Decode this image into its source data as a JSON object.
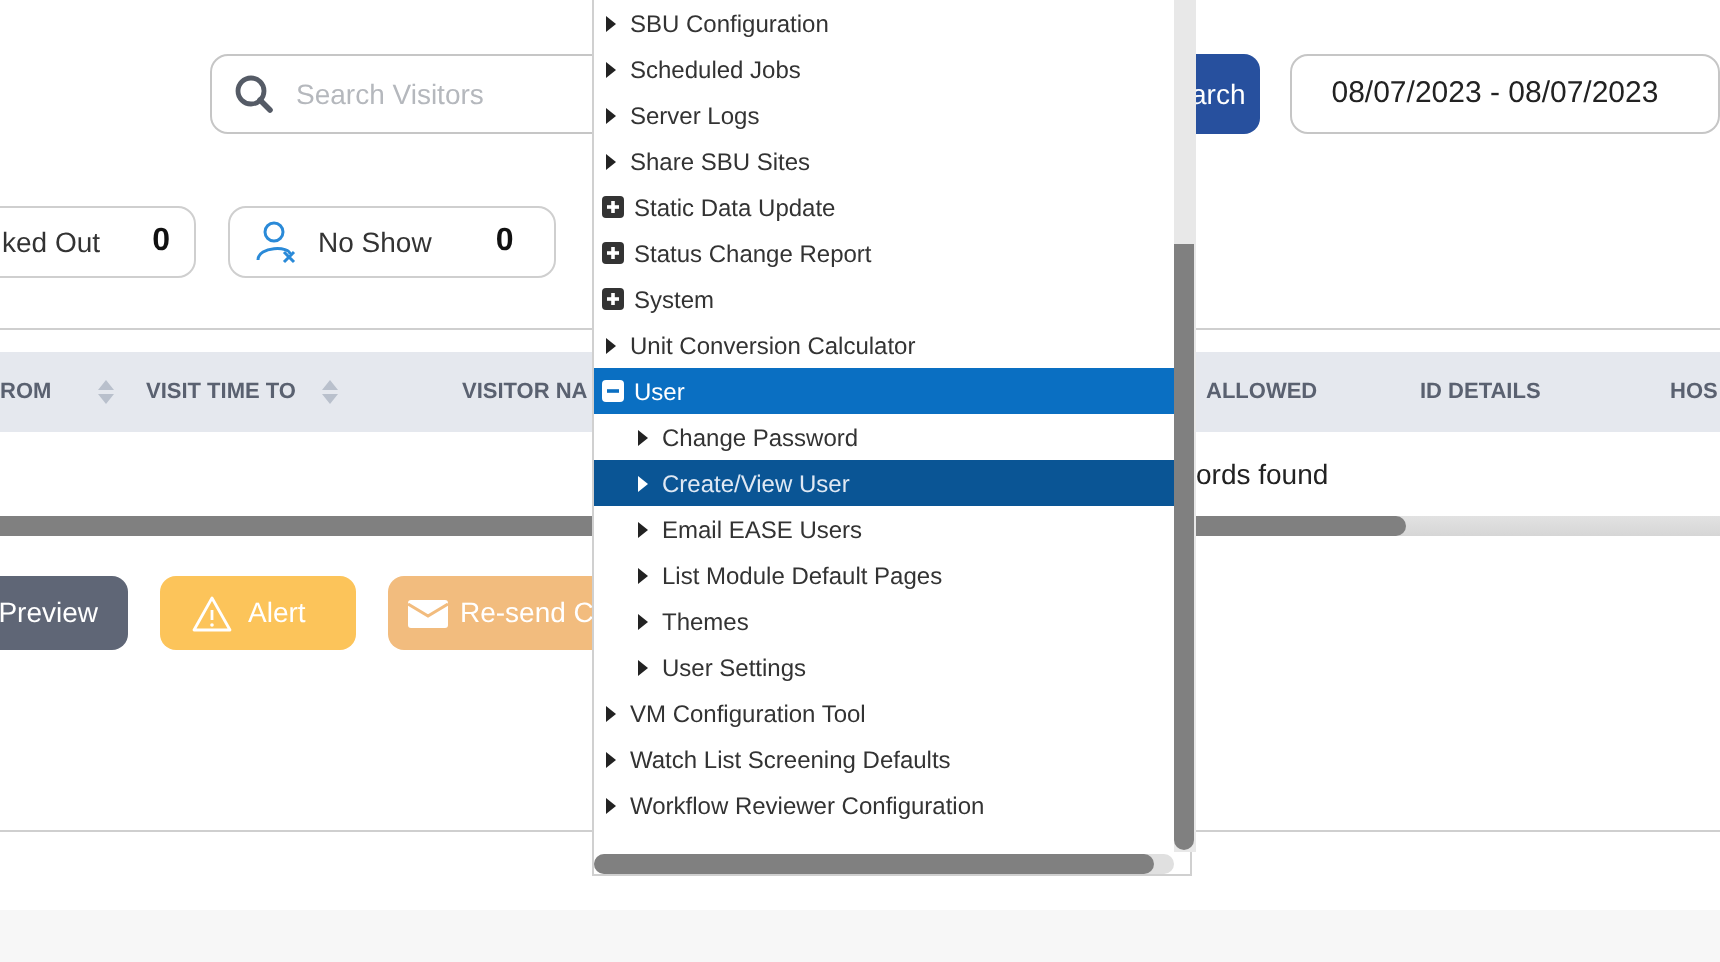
{
  "search": {
    "placeholder": "Search Visitors"
  },
  "search_button": {
    "label": "arch"
  },
  "date_range": {
    "value": "08/07/2023 - 08/07/2023"
  },
  "stat_cards": [
    {
      "label": "ked Out",
      "count": "0",
      "kind": "plain"
    },
    {
      "label": "No Show",
      "count": "0",
      "kind": "no-show"
    }
  ],
  "table": {
    "columns": [
      {
        "label": "ROM",
        "sortable": true
      },
      {
        "label": "VISIT TIME TO",
        "sortable": true
      },
      {
        "label": "VISITOR NA"
      },
      {
        "label": "ALLOWED",
        "sortable": false
      },
      {
        "label": "ID DETAILS",
        "sortable": false
      },
      {
        "label": "HOS"
      }
    ],
    "empty_message": "ords found"
  },
  "actions": [
    {
      "label": "Preview",
      "kind": "preview"
    },
    {
      "label": "Alert",
      "kind": "alert"
    },
    {
      "label": "Re-send C",
      "kind": "resend"
    }
  ],
  "menu": {
    "items": [
      {
        "label": "SBU Configuration",
        "kind": "link",
        "selected": false,
        "hovered": false
      },
      {
        "label": "Scheduled Jobs",
        "kind": "link",
        "selected": false,
        "hovered": false
      },
      {
        "label": "Server Logs",
        "kind": "link",
        "selected": false,
        "hovered": false
      },
      {
        "label": "Share SBU Sites",
        "kind": "link",
        "selected": false,
        "hovered": false
      },
      {
        "label": "Static Data Update",
        "kind": "group",
        "expanded": false,
        "selected": false,
        "hovered": false
      },
      {
        "label": "Status Change Report",
        "kind": "group",
        "expanded": false,
        "selected": false,
        "hovered": false
      },
      {
        "label": "System",
        "kind": "group",
        "expanded": false,
        "selected": false,
        "hovered": false
      },
      {
        "label": "Unit Conversion Calculator",
        "kind": "link",
        "selected": false,
        "hovered": false
      },
      {
        "label": "User",
        "kind": "group",
        "expanded": true,
        "selected": true,
        "hovered": false,
        "children": [
          {
            "label": "Change Password",
            "kind": "link",
            "selected": false,
            "hovered": false
          },
          {
            "label": "Create/View User",
            "kind": "link",
            "selected": false,
            "hovered": true
          },
          {
            "label": "Email EASE Users",
            "kind": "link",
            "selected": false,
            "hovered": false
          },
          {
            "label": "List Module Default Pages",
            "kind": "link",
            "selected": false,
            "hovered": false
          },
          {
            "label": "Themes",
            "kind": "link",
            "selected": false,
            "hovered": false
          },
          {
            "label": "User Settings",
            "kind": "link",
            "selected": false,
            "hovered": false
          }
        ]
      },
      {
        "label": "VM Configuration Tool",
        "kind": "link",
        "selected": false,
        "hovered": false
      },
      {
        "label": "Watch List Screening Defaults",
        "kind": "link",
        "selected": false,
        "hovered": false
      },
      {
        "label": "Workflow Reviewer Configuration",
        "kind": "link",
        "selected": false,
        "hovered": false
      }
    ]
  }
}
